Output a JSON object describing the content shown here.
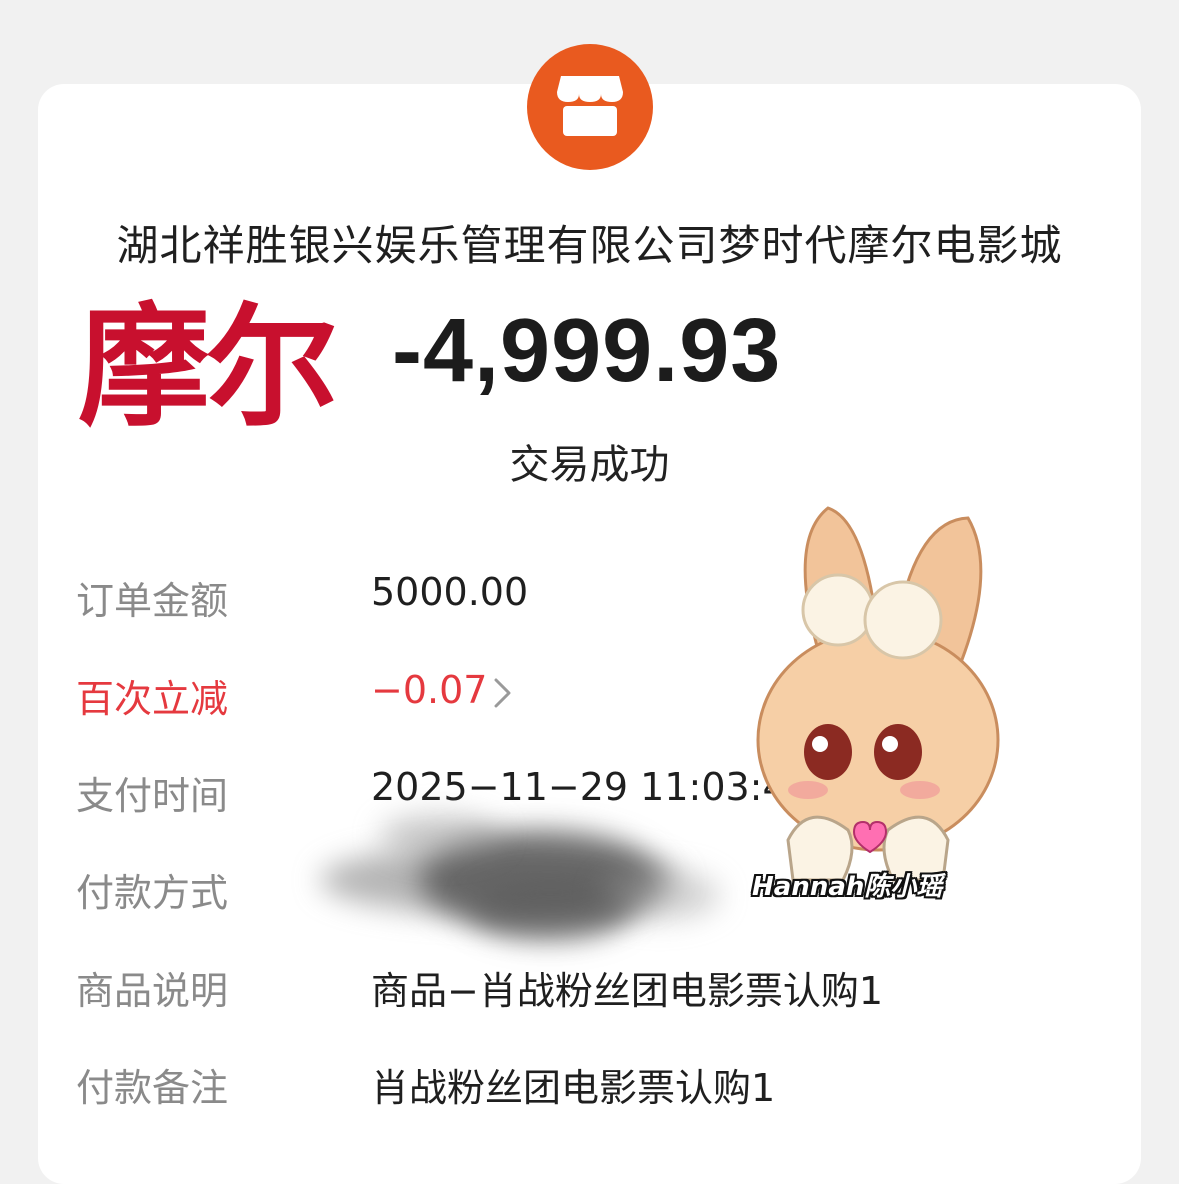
{
  "merchant": {
    "name": "湖北祥胜银兴娱乐管理有限公司梦时代摩尔电影城",
    "logo_text": "摩尔",
    "icon": "storefront-icon"
  },
  "transaction": {
    "amount": "-4,999.93",
    "status": "交易成功"
  },
  "details": [
    {
      "label": "订单金额",
      "value": "5000.00"
    },
    {
      "label": "百次立减",
      "value": "−0.07"
    },
    {
      "label": "支付时间",
      "value": "2025−11−29 11:03:43"
    },
    {
      "label": "付款方式",
      "value": ""
    },
    {
      "label": "商品说明",
      "value": "商品−肖战粉丝团电影票认购1"
    },
    {
      "label": "付款备注",
      "value": "肖战粉丝团电影票认购1"
    }
  ],
  "sticker": {
    "caption": "Hannah陈小瑶"
  },
  "colors": {
    "background": "#f1f1f1",
    "icon_bg": "#e95a1f",
    "logo_red": "#c8102e",
    "discount_red": "#e5393f",
    "label_gray": "#8a8a8a"
  }
}
